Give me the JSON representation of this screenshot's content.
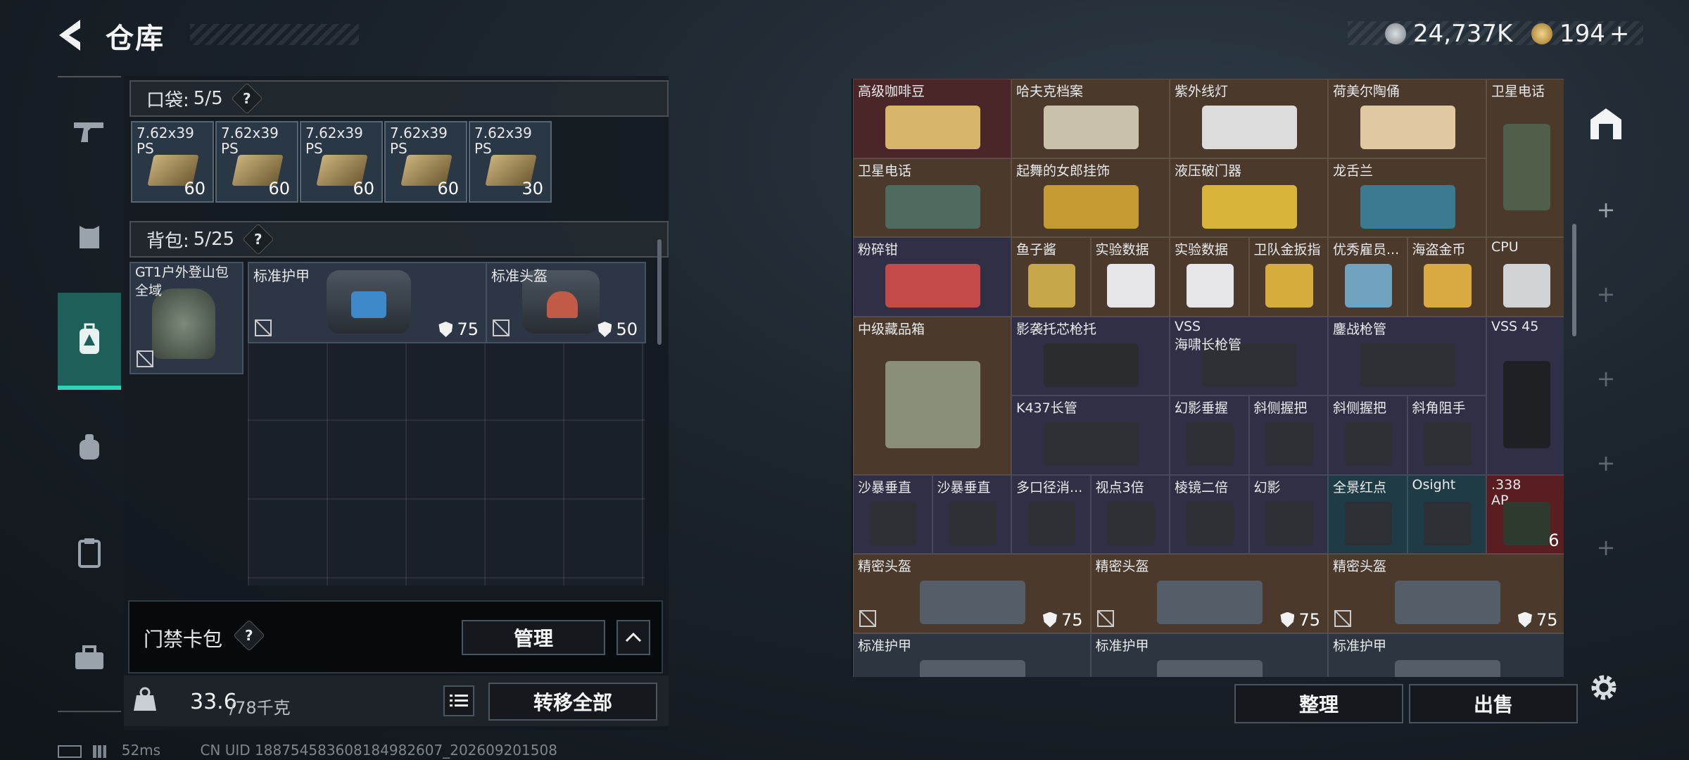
{
  "header": {
    "title": "仓库",
    "currency1": "24,737K",
    "currency2": "194",
    "currency2_plus": "+"
  },
  "pocket": {
    "label": "口袋:",
    "count": "5/5",
    "help": "?",
    "items": [
      {
        "name": "7.62x39",
        "sub": "PS",
        "qty": "60"
      },
      {
        "name": "7.62x39",
        "sub": "PS",
        "qty": "60"
      },
      {
        "name": "7.62x39",
        "sub": "PS",
        "qty": "60"
      },
      {
        "name": "7.62x39",
        "sub": "PS",
        "qty": "60"
      },
      {
        "name": "7.62x39",
        "sub": "PS",
        "qty": "30"
      }
    ]
  },
  "backpack": {
    "label": "背包:",
    "count": "5/25",
    "help": "?",
    "bag_name": "GT1户外登山包",
    "bag_sub": "全域",
    "items": [
      {
        "name": "标准护甲",
        "armor": "75"
      },
      {
        "name": "标准头盔",
        "armor": "50"
      }
    ]
  },
  "keycard": {
    "label": "门禁卡包",
    "help": "?",
    "manage": "管理"
  },
  "footer": {
    "weight": "33.6",
    "weight_max": "/78千克",
    "transfer_all": "转移全部",
    "sort": "整理",
    "sell": "出售"
  },
  "status": {
    "ping": "52ms",
    "uid": "CN UID 18875458360818498260​7_202609201508"
  },
  "stash": [
    {
      "name": "高级咖啡豆",
      "color": "c-red"
    },
    {
      "name": "哈夫克档案",
      "color": "c-brown"
    },
    {
      "name": "紫外线灯",
      "color": "c-brown"
    },
    {
      "name": "荷美尔陶俑",
      "color": "c-brown"
    },
    {
      "name": "卫星电话",
      "color": "c-brown"
    },
    {
      "name": "卫星电话",
      "color": "c-brown"
    },
    {
      "name": "起舞的女郎挂饰",
      "color": "c-brown"
    },
    {
      "name": "液压破门器",
      "color": "c-brown"
    },
    {
      "name": "龙舌兰",
      "color": "c-brown"
    },
    {
      "name": "粉碎钳",
      "color": "c-purple"
    },
    {
      "name": "鱼子酱",
      "color": "c-brown"
    },
    {
      "name": "实验数据",
      "color": "c-brown"
    },
    {
      "name": "实验数据",
      "color": "c-brown"
    },
    {
      "name": "卫队金扳指",
      "color": "c-brown"
    },
    {
      "name": "优秀雇员...",
      "color": "c-brown"
    },
    {
      "name": "海盗金币",
      "color": "c-brown"
    },
    {
      "name": "CPU",
      "color": "c-brown"
    },
    {
      "name": "中级藏品箱",
      "color": "c-brown"
    },
    {
      "name": "影袭托芯枪托",
      "color": "c-purple"
    },
    {
      "name": "VSS\n海啸长枪管",
      "color": "c-purple"
    },
    {
      "name": "鏖战枪管",
      "color": "c-purple"
    },
    {
      "name": "VSS 45",
      "color": "c-purple"
    },
    {
      "name": "K437长管",
      "color": "c-purple"
    },
    {
      "name": "幻影垂握",
      "color": "c-purple"
    },
    {
      "name": "斜侧握把",
      "color": "c-purple"
    },
    {
      "name": "斜侧握把",
      "color": "c-purple"
    },
    {
      "name": "斜角阻手",
      "color": "c-purple"
    },
    {
      "name": "沙暴垂直",
      "color": "c-purple"
    },
    {
      "name": "沙暴垂直",
      "color": "c-purple"
    },
    {
      "name": "多口径消...",
      "color": "c-purple"
    },
    {
      "name": "视点3倍",
      "color": "c-purple"
    },
    {
      "name": "棱镜二倍",
      "color": "c-purple"
    },
    {
      "name": "幻影",
      "color": "c-purple"
    },
    {
      "name": "全景红点",
      "color": "c-teal"
    },
    {
      "name": "Osight",
      "color": "c-teal"
    },
    {
      "name": ".338\nAP",
      "color": "c-crimson",
      "qty": "6"
    },
    {
      "name": "精密头盔",
      "color": "c-brown",
      "armor": "75"
    },
    {
      "name": "精密头盔",
      "color": "c-brown",
      "armor": "75"
    },
    {
      "name": "精密头盔",
      "color": "c-brown",
      "armor": "75"
    },
    {
      "name": "标准护甲",
      "color": "c-gray"
    },
    {
      "name": "标准护甲",
      "color": "c-gray"
    },
    {
      "name": "标准护甲",
      "color": "c-gray"
    }
  ]
}
